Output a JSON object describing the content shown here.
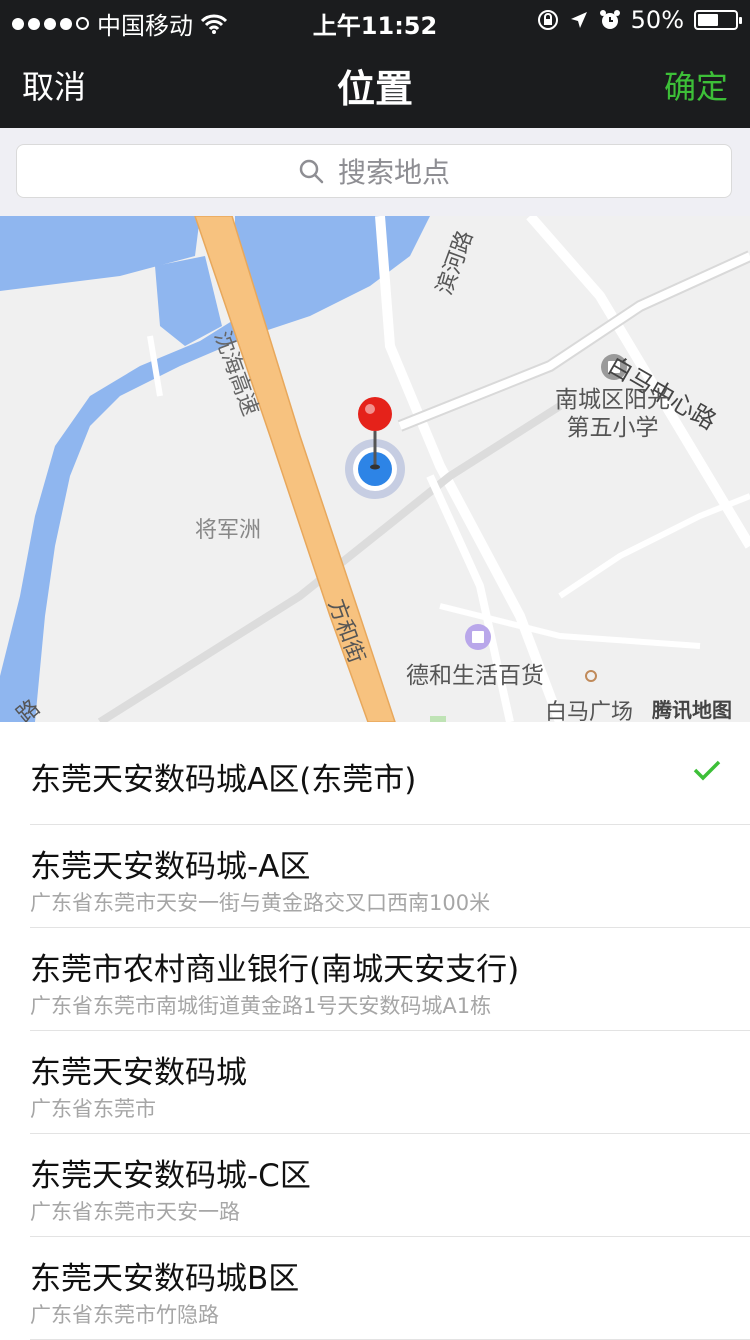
{
  "statusbar": {
    "carrier": "中国移动",
    "time": "上午11:52",
    "battery": "50%"
  },
  "nav": {
    "cancel": "取消",
    "title": "位置",
    "confirm": "确定"
  },
  "search": {
    "placeholder": "搜索地点"
  },
  "map": {
    "labels": {
      "shenhai": "沈海高速",
      "binhe": "滨河路",
      "baima_center": "白马中心路",
      "school": "南城区阳光\n第五小学",
      "jiangjunzhou": "将军洲",
      "fanghe": "方和街",
      "dehe": "德和生活百货",
      "baima_square": "白马广场",
      "watermark": "腾讯地图",
      "edge_road": "路"
    },
    "colors": {
      "water": "#8fb6ef",
      "highway": "#f7c27f",
      "background": "#f0f0f0"
    }
  },
  "list": [
    {
      "title": "东莞天安数码城A区(东莞市)",
      "sub": "",
      "selected": true
    },
    {
      "title": "东莞天安数码城-A区",
      "sub": "广东省东莞市天安一街与黄金路交叉口西南100米",
      "selected": false
    },
    {
      "title": "东莞市农村商业银行(南城天安支行)",
      "sub": "广东省东莞市南城街道黄金路1号天安数码城A1栋",
      "selected": false
    },
    {
      "title": "东莞天安数码城",
      "sub": "广东省东莞市",
      "selected": false
    },
    {
      "title": "东莞天安数码城-C区",
      "sub": "广东省东莞市天安一路",
      "selected": false
    },
    {
      "title": "东莞天安数码城B区",
      "sub": "广东省东莞市竹隐路",
      "selected": false
    }
  ],
  "accent": "#3dbf38"
}
